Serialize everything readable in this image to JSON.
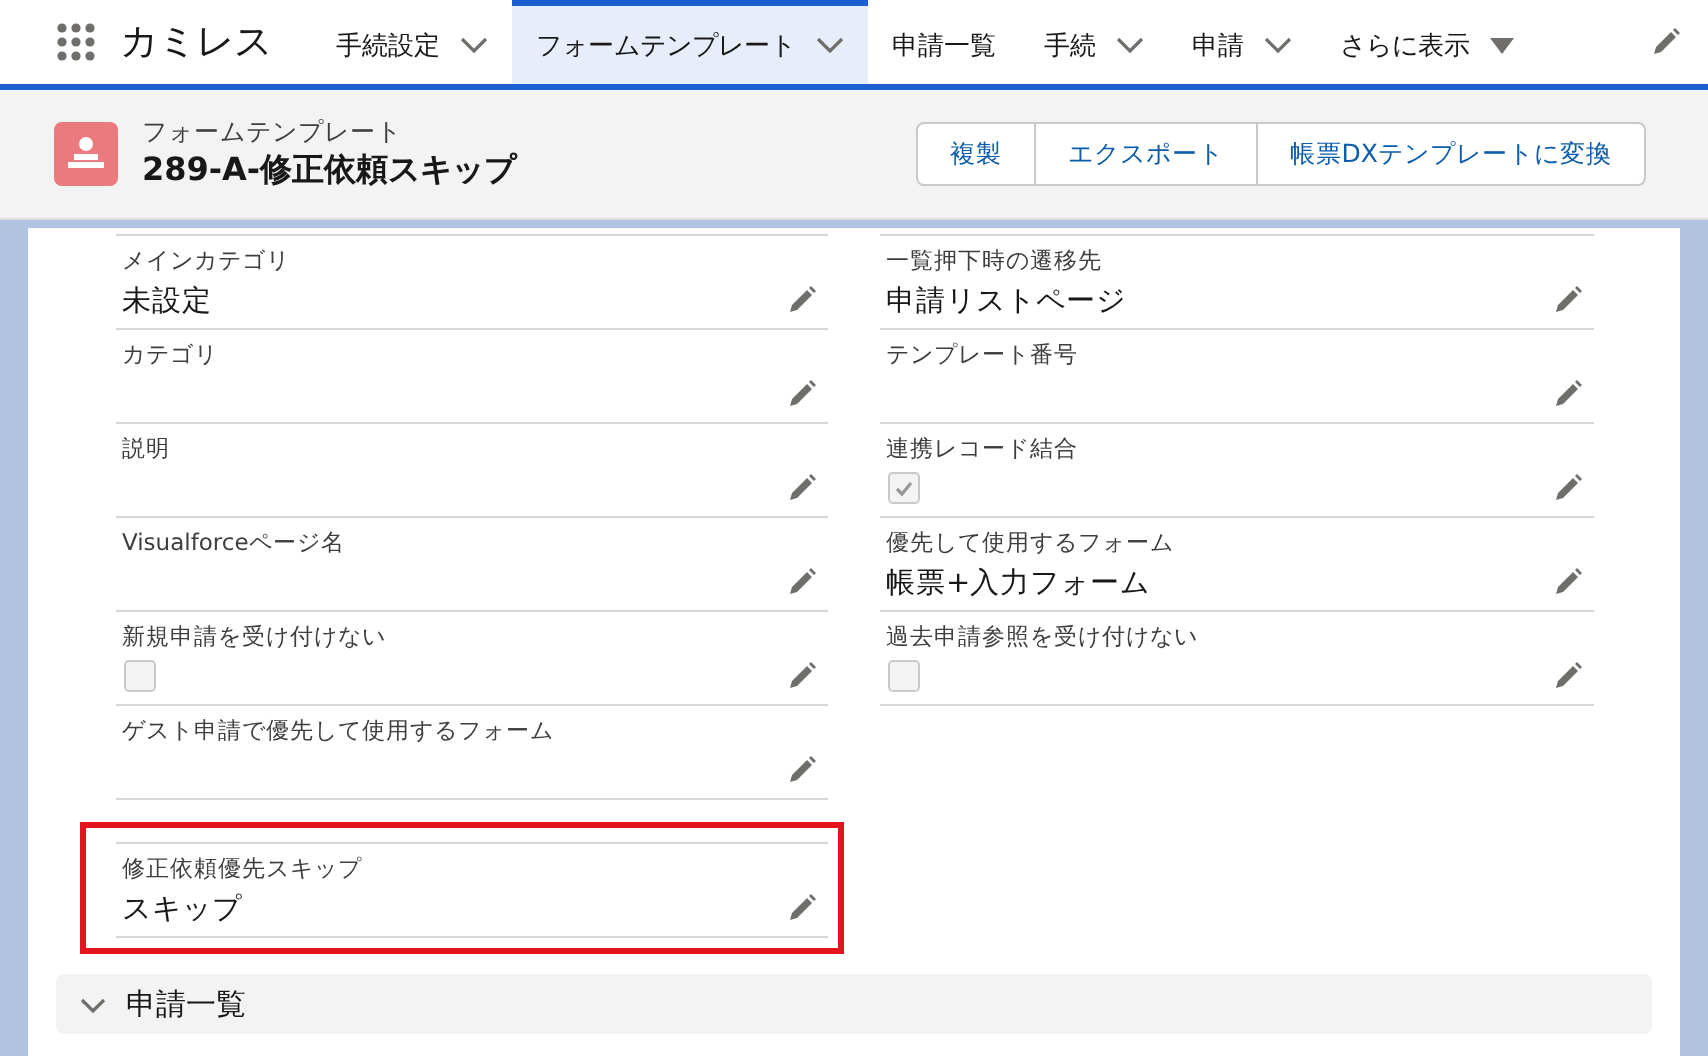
{
  "app": {
    "name": "カミレス"
  },
  "nav": [
    {
      "label": "手続設定",
      "kind": "chevron",
      "selected": false
    },
    {
      "label": "フォームテンプレート",
      "kind": "chevron",
      "selected": true
    },
    {
      "label": "申請一覧",
      "kind": "plain",
      "selected": false
    },
    {
      "label": "手続",
      "kind": "chevron",
      "selected": false
    },
    {
      "label": "申請",
      "kind": "chevron",
      "selected": false
    },
    {
      "label": "さらに表示",
      "kind": "triangle",
      "selected": false
    }
  ],
  "header": {
    "object_type": "フォームテンプレート",
    "title": "289-A-修正依頼スキップ",
    "buttons": [
      "複製",
      "エクスポート",
      "帳票DXテンプレートに変換"
    ]
  },
  "rows": [
    {
      "left": {
        "label": "メインカテゴリ",
        "kind": "text",
        "value": "未設定"
      },
      "right": {
        "label": "一覧押下時の遷移先",
        "kind": "text",
        "value": "申請リストページ"
      }
    },
    {
      "left": {
        "label": "カテゴリ",
        "kind": "text"
      },
      "right": {
        "label": "テンプレート番号",
        "kind": "text"
      }
    },
    {
      "left": {
        "label": "説明",
        "kind": "text"
      },
      "right": {
        "label": "連携レコード結合",
        "kind": "checkbox",
        "checked": true
      }
    },
    {
      "left": {
        "label": "Visualforceページ名",
        "kind": "text"
      },
      "right": {
        "label": "優先して使用するフォーム",
        "kind": "text",
        "value": "帳票+入力フォーム"
      }
    },
    {
      "left": {
        "label": "新規申請を受け付けない",
        "kind": "checkbox",
        "checked": false
      },
      "right": {
        "label": "過去申請参照を受け付けない",
        "kind": "checkbox",
        "checked": false
      }
    },
    {
      "left": {
        "label": "ゲスト申請で優先して使用するフォーム",
        "kind": "text"
      }
    },
    {
      "left": {
        "label": "修正依頼優先スキップ",
        "kind": "text",
        "value": "スキップ",
        "highlighted": true
      }
    }
  ],
  "section": {
    "title": "申請一覧",
    "expanded": true
  }
}
